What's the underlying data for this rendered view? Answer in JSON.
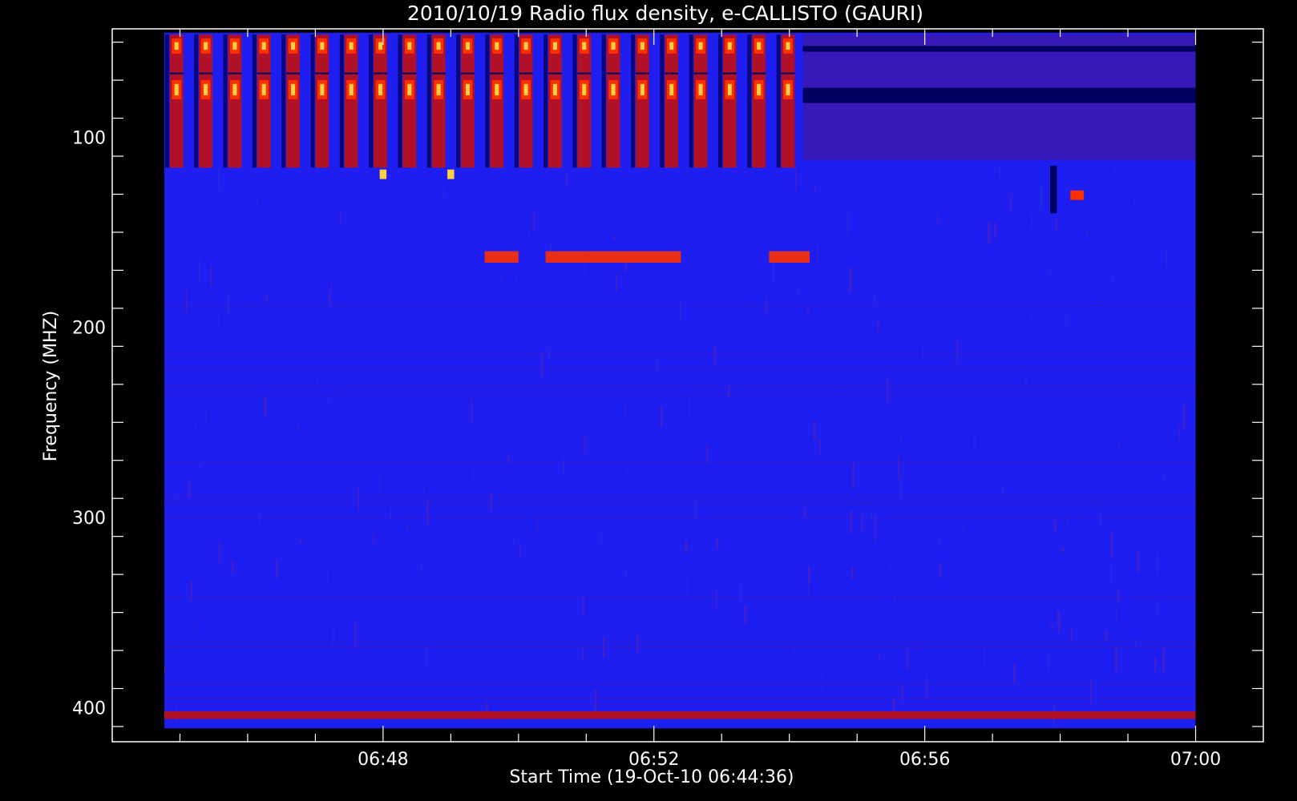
{
  "chart_data": {
    "type": "heatmap",
    "title": "2010/10/19  Radio flux density, e-CALLISTO (GAURI)",
    "xlabel": "Start Time (19-Oct-10 06:44:36)",
    "ylabel": "Frequency (MHZ)",
    "x_ticks": [
      {
        "label": "06:48",
        "minutes": 408
      },
      {
        "label": "06:52",
        "minutes": 412
      },
      {
        "label": "06:56",
        "minutes": 416
      },
      {
        "label": "07:00",
        "minutes": 420
      }
    ],
    "y_ticks": [
      {
        "label": "100",
        "value": 100
      },
      {
        "label": "200",
        "value": 200
      },
      {
        "label": "300",
        "value": 300
      },
      {
        "label": "400",
        "value": 400
      }
    ],
    "x_range_minutes": [
      404.0,
      421.0
    ],
    "y_range_mhz": [
      43,
      418
    ],
    "data_x_range_minutes": [
      404.77,
      420.0
    ],
    "data_y_range_mhz": [
      45,
      411
    ],
    "grid": false,
    "legend": "none",
    "colors": {
      "background": "#000000",
      "frame": "#ffffff",
      "base": "#1e1ef0",
      "low": "#000060",
      "medium": "#c01010",
      "high": "#ff3000",
      "peak": "#ffd040"
    },
    "features": [
      {
        "kind": "periodic-bursts",
        "t_start": 404.85,
        "t_end": 414.2,
        "period_min": 0.43,
        "width_min": 0.2,
        "f_low": 46,
        "f_high": 116,
        "intensity": "high"
      },
      {
        "kind": "band",
        "t_start": 414.2,
        "t_end": 420.0,
        "f_low": 46,
        "f_high": 112,
        "intensity": "low-medium"
      },
      {
        "kind": "band",
        "t_start": 410.4,
        "t_end": 412.4,
        "f_low": 160,
        "f_high": 166,
        "intensity": "high"
      },
      {
        "kind": "band",
        "t_start": 409.5,
        "t_end": 410.0,
        "f_low": 160,
        "f_high": 166,
        "intensity": "high"
      },
      {
        "kind": "band",
        "t_start": 413.7,
        "t_end": 414.3,
        "f_low": 160,
        "f_high": 166,
        "intensity": "high"
      },
      {
        "kind": "dark-gap",
        "t_start": 417.85,
        "t_end": 417.95,
        "f_low": 115,
        "f_high": 140,
        "intensity": "low"
      },
      {
        "kind": "spot",
        "t_start": 418.15,
        "t_end": 418.35,
        "f_low": 128,
        "f_high": 133,
        "intensity": "high"
      },
      {
        "kind": "spot",
        "t_start": 407.95,
        "t_end": 408.05,
        "f_low": 117,
        "f_high": 122,
        "intensity": "peak"
      },
      {
        "kind": "spot",
        "t_start": 408.95,
        "t_end": 409.05,
        "f_low": 117,
        "f_high": 122,
        "intensity": "peak"
      },
      {
        "kind": "band",
        "t_start": 404.77,
        "t_end": 420.0,
        "f_low": 402,
        "f_high": 406,
        "intensity": "medium"
      }
    ]
  }
}
